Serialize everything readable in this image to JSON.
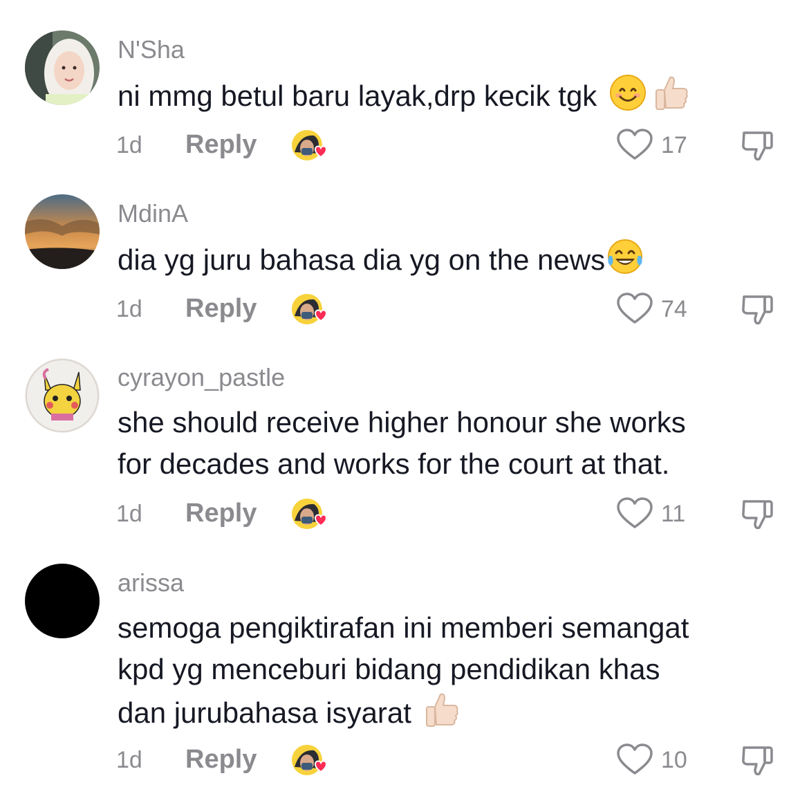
{
  "comments": [
    {
      "username": "N'Sha",
      "lines": [
        "ni mmg betul baru layak,drp kecik tgk"
      ],
      "time": "1d",
      "reply": "Reply",
      "likes": "17",
      "avatar_icon": "avatar-woman-hijab"
    },
    {
      "username": "MdinA",
      "lines": [
        "dia yg juru bahasa dia yg on the news"
      ],
      "time": "1d",
      "reply": "Reply",
      "likes": "74",
      "avatar_icon": "avatar-sunset-sky"
    },
    {
      "username": "cyrayon_pastle",
      "lines": [
        "she should receive higher honour she works",
        "for decades and works for the court at that."
      ],
      "time": "1d",
      "reply": "Reply",
      "likes": "11",
      "avatar_icon": "avatar-pikachu-drawing"
    },
    {
      "username": "arissa",
      "lines": [
        "semoga pengiktirafan ini memberi semangat",
        "kpd yg menceburi bidang pendidikan khas",
        "dan jurubahasa isyarat"
      ],
      "time": "1d",
      "reply": "Reply",
      "likes": "10",
      "avatar_icon": "avatar-black"
    }
  ],
  "colors": {
    "text": "#161823",
    "muted": "#8a8a8f",
    "heart_badge": "#fe2c55"
  }
}
